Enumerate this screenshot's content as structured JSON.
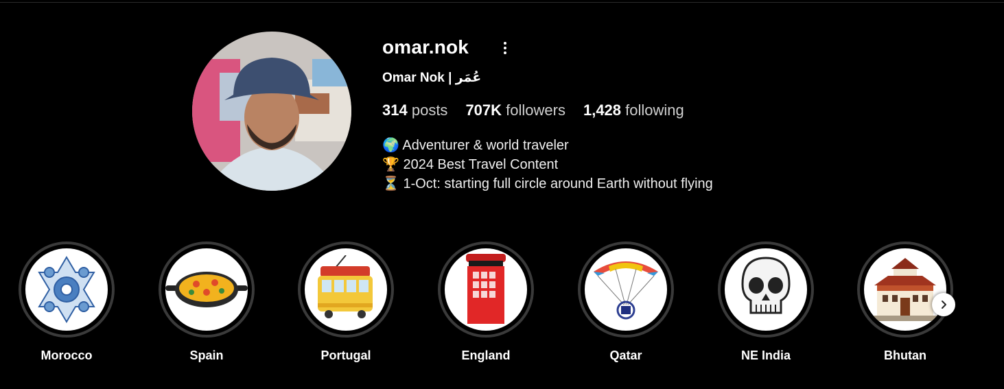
{
  "profile": {
    "username": "omar.nok",
    "full_name": "Omar Nok | عُمَر",
    "stats": [
      {
        "num": "314",
        "label": "posts"
      },
      {
        "num": "707K",
        "label": "followers"
      },
      {
        "num": "1,428",
        "label": "following"
      }
    ],
    "bio": [
      "🌍 Adventurer & world traveler",
      "🏆 2024 Best Travel Content",
      "⏳ 1-Oct: starting full circle around Earth without flying"
    ]
  },
  "highlights": [
    {
      "label": "Morocco",
      "icon": "moroccan-tile-icon"
    },
    {
      "label": "Spain",
      "icon": "paella-pan-icon"
    },
    {
      "label": "Portugal",
      "icon": "tram-icon"
    },
    {
      "label": "England",
      "icon": "phone-booth-icon"
    },
    {
      "label": "Qatar",
      "icon": "paramotor-icon"
    },
    {
      "label": "NE India",
      "icon": "skull-icon"
    },
    {
      "label": "Bhutan",
      "icon": "dzong-icon"
    }
  ],
  "colors": {
    "background": "#000000",
    "text": "#ffffff",
    "muted": "#d0d0d0",
    "ring": "#3a3a3a"
  }
}
